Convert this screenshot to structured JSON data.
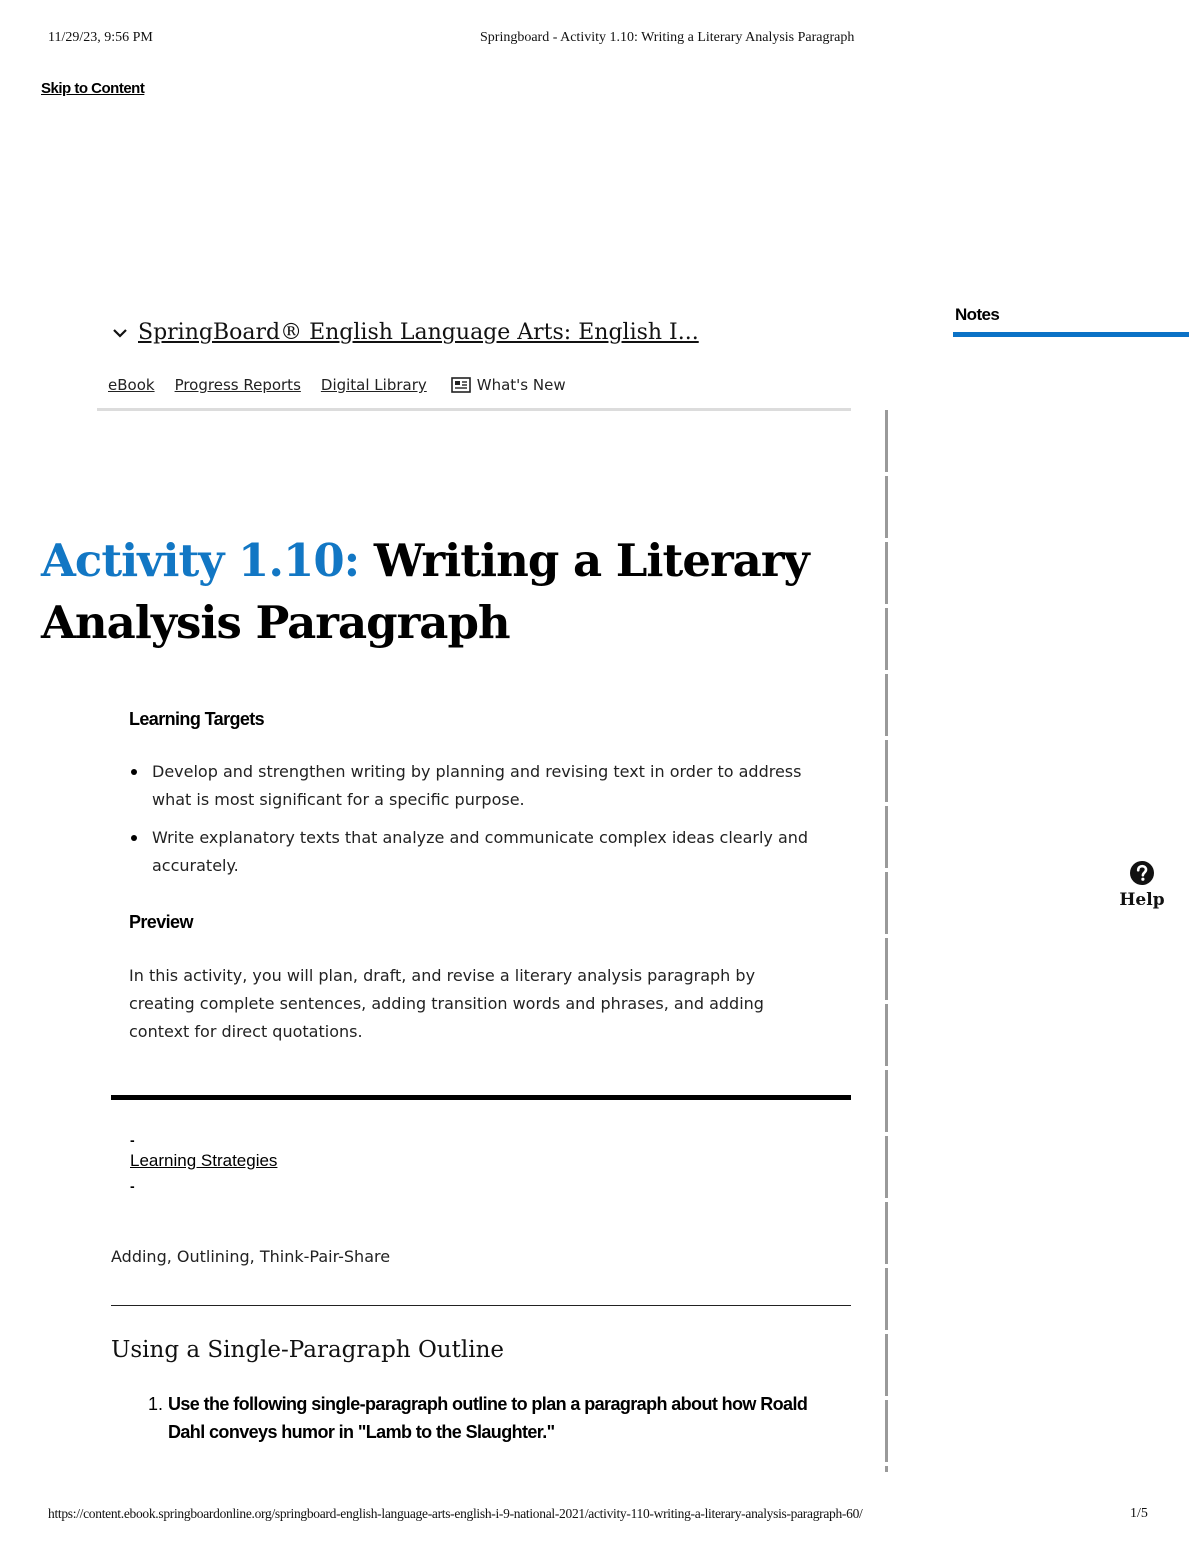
{
  "print_header": {
    "datetime": "11/29/23, 9:56 PM",
    "page_title": "Springboard - Activity 1.10: Writing a Literary Analysis Paragraph"
  },
  "skip_link": "Skip to Content",
  "breadcrumb": {
    "course_title": "SpringBoard® English Language Arts: English I..."
  },
  "nav": {
    "ebook": "eBook",
    "progress_reports": "Progress Reports",
    "digital_library": "Digital Library",
    "whats_new": "What's New"
  },
  "notes_panel": {
    "label": "Notes"
  },
  "activity": {
    "number_label": "Activity 1.10:",
    "title": "Writing a Literary Analysis Paragraph",
    "learning_targets_heading": "Learning Targets",
    "learning_targets": [
      "Develop and strengthen writing by planning and revising text in order to address what is most significant for a specific purpose.",
      "Write explanatory texts that analyze and communicate complex ideas clearly and accurately."
    ],
    "preview_heading": "Preview",
    "preview_text": "In this activity, you will plan, draft, and revise a literary analysis paragraph by creating complete sentences, adding transition words and phrases, and adding context for direct quotations.",
    "learning_strategies_label": "Learning Strategies",
    "learning_strategies_dash": "-",
    "strategies": "Adding, Outlining, Think-Pair-Share",
    "section_heading": "Using a Single-Paragraph Outline",
    "question_number": "1.",
    "question_text": "Use the following single-paragraph outline to plan a paragraph about how Roald Dahl conveys humor in \"Lamb to the Slaughter.\""
  },
  "help": {
    "label": "Help"
  },
  "print_footer": {
    "url": "https://content.ebook.springboardonline.org/springboard-english-language-arts-english-i-9-national-2021/activity-110-writing-a-literary-analysis-paragraph-60/",
    "page": "1/5"
  },
  "colors": {
    "accent_blue": "#1277c4",
    "notes_bar": "#0b72c6"
  }
}
